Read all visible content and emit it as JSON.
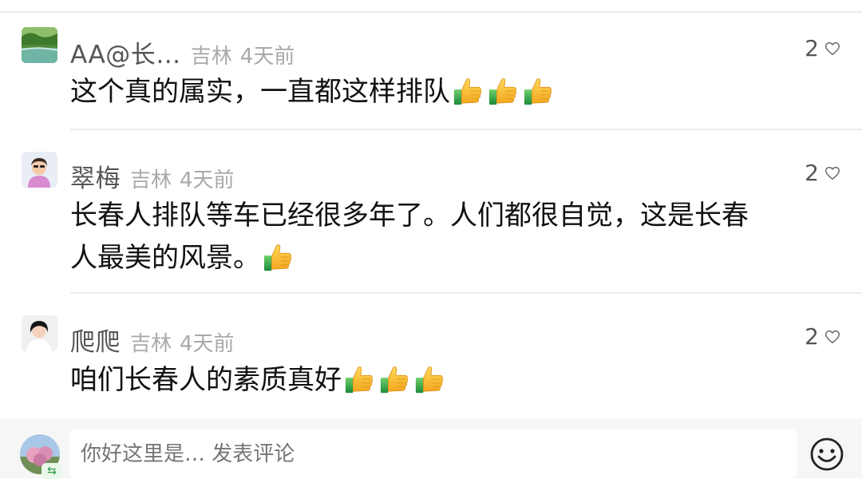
{
  "comments": [
    {
      "username": "AA@长…",
      "location": "吉林",
      "time": "4天前",
      "likes": "2",
      "text": "这个真的属实，一直都这样排队",
      "emoji_count": 3,
      "avatar": "landscape-avatar"
    },
    {
      "username": "翠梅",
      "location": "吉林",
      "time": "4天前",
      "likes": "2",
      "text_line1": "长春人排队等车已经很多年了。人们都很自觉，这是长春",
      "text_line2": "人最美的风景。",
      "emoji_count": 1,
      "avatar": "woman-avatar"
    },
    {
      "username": "爬爬",
      "location": "吉林",
      "time": "4天前",
      "likes": "2",
      "text": "咱们长春人的素质真好",
      "emoji_count": 3,
      "avatar": "woman-portrait-avatar"
    }
  ],
  "composer": {
    "placeholder": "你好这里是… 发表评论",
    "emoji_icon": "smiley-icon"
  },
  "icons": {
    "like": "heart-outline-icon",
    "thumb": "thumbs-up-emoji"
  },
  "colors": {
    "username": "#555555",
    "meta": "#a9a9a9",
    "text": "#111111",
    "divider": "#ededed",
    "composer_bg": "#f6f6f6"
  }
}
